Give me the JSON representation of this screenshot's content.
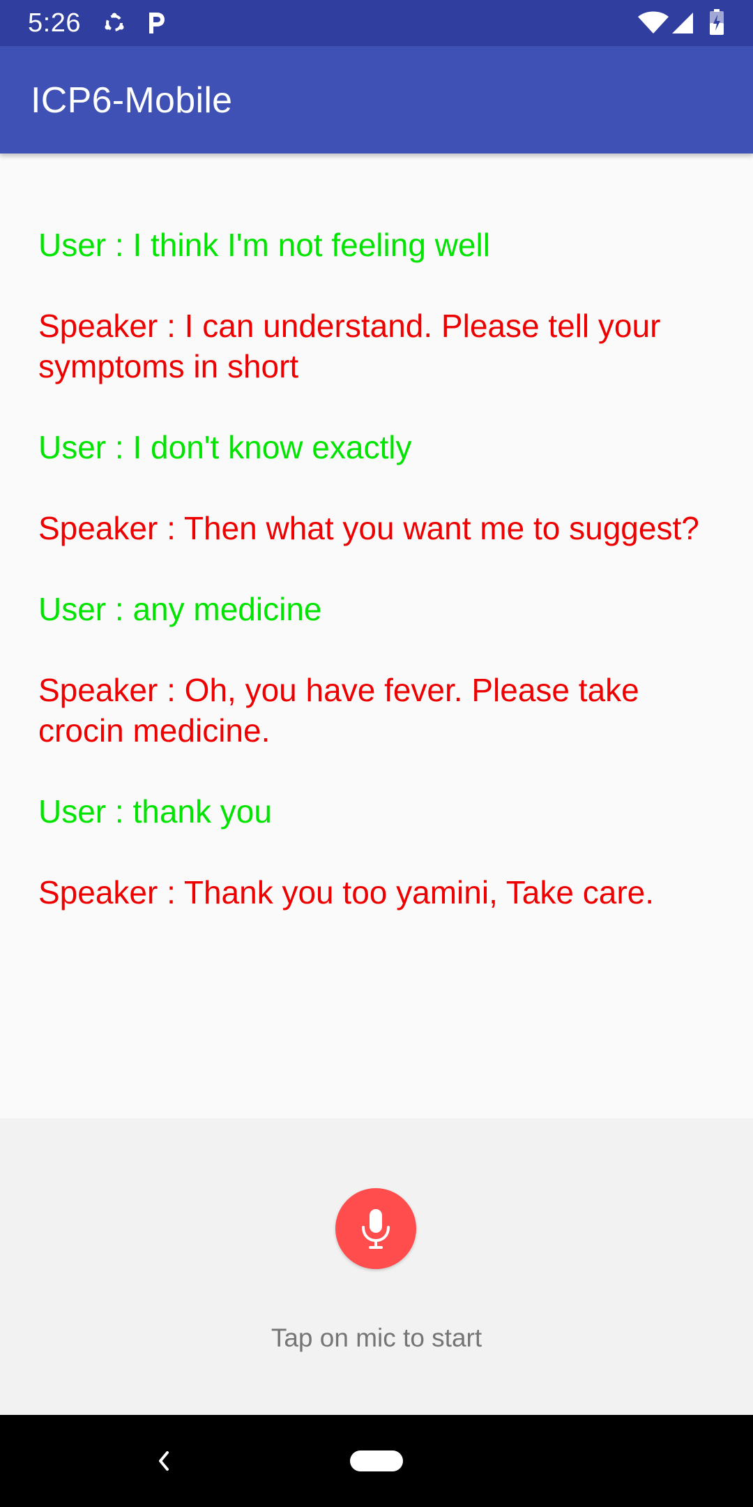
{
  "status_bar": {
    "time": "5:26",
    "icons": [
      "sync-icon",
      "parking-icon",
      "wifi-icon",
      "signal-icon",
      "battery-icon"
    ],
    "color": "#303f9f"
  },
  "app_bar": {
    "title": "ICP6-Mobile",
    "color": "#3f51b5"
  },
  "conversation": {
    "user_color": "#00e400",
    "speaker_color": "#ee0000",
    "messages": [
      {
        "role": "user",
        "text": "User : I think I'm not feeling well"
      },
      {
        "role": "speaker",
        "text": "Speaker : I can understand. Please tell your symptoms in short"
      },
      {
        "role": "user",
        "text": "User : I don't know exactly"
      },
      {
        "role": "speaker",
        "text": "Speaker : Then what you want me to suggest?"
      },
      {
        "role": "user",
        "text": "User : any medicine"
      },
      {
        "role": "speaker",
        "text": "Speaker : Oh, you have fever. Please take crocin medicine."
      },
      {
        "role": "user",
        "text": "User : thank you"
      },
      {
        "role": "speaker",
        "text": "Speaker : Thank you too yamini, Take care."
      }
    ]
  },
  "mic": {
    "icon": "microphone-icon",
    "color": "#ff4c4c",
    "hint": "Tap on mic to start"
  },
  "nav_bar": {
    "back_icon": "back-chevron-icon",
    "home_icon": "home-pill-icon"
  }
}
